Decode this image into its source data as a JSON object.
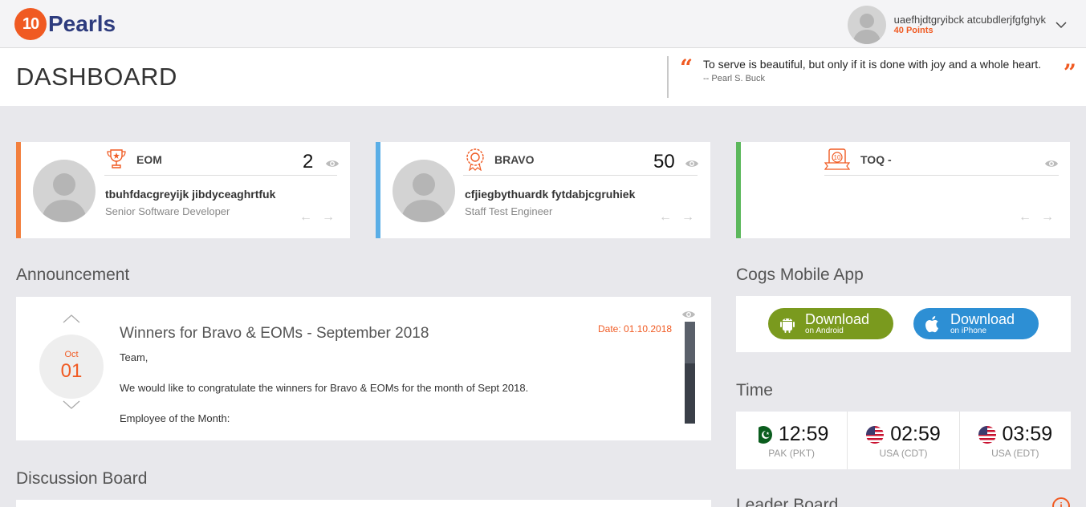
{
  "brand": {
    "logo_mark": "10",
    "logo_text": "Pearls"
  },
  "user": {
    "name": "uaefhjdtgryibck atcubdlerjfgfghyk",
    "points": "40 Points",
    "menu_icon": "chevron-down-icon"
  },
  "header": {
    "title": "DASHBOARD",
    "quote": "To serve is beautiful, but only if it is done with joy and a whole heart.",
    "quote_author": "-- Pearl S. Buck"
  },
  "awards": [
    {
      "title": "EOM",
      "count": "2",
      "name": "tbuhfdacgreyijk jibdyceaghrtfuk",
      "role": "Senior Software Developer",
      "accent": "#f27f3d",
      "icon": "trophy-icon"
    },
    {
      "title": "BRAVO",
      "count": "50",
      "name": "cfjiegbythuardk fytdabjcgruhiek",
      "role": "Staff Test Engineer",
      "accent": "#5aaee6",
      "icon": "medal-icon"
    },
    {
      "title": "TOQ -",
      "count": "",
      "name": "",
      "role": "",
      "accent": "#5cb85c",
      "icon": "ribbon-icon"
    }
  ],
  "announcement": {
    "heading": "Announcement",
    "month": "Oct",
    "day": "01",
    "title": "Winners for Bravo & EOMs - September 2018",
    "date_label": "Date: 01.10.2018",
    "body": [
      "Team,",
      "We would like to congratulate the winners for Bravo & EOMs for the month of Sept 2018.",
      "Employee of the Month:"
    ]
  },
  "discussion": {
    "heading": "Discussion Board"
  },
  "mobile_app": {
    "heading": "Cogs Mobile App",
    "android": {
      "main": "Download",
      "sub": "on Android",
      "color": "#7a9a1e"
    },
    "iphone": {
      "main": "Download",
      "sub": "on iPhone",
      "color": "#2d8fd4"
    }
  },
  "time": {
    "heading": "Time",
    "clocks": [
      {
        "time": "12:59",
        "zone": "PAK (PKT)",
        "flag": "pakistan-flag-icon"
      },
      {
        "time": "02:59",
        "zone": "USA (CDT)",
        "flag": "usa-flag-icon"
      },
      {
        "time": "03:59",
        "zone": "USA (EDT)",
        "flag": "usa-flag-icon"
      }
    ]
  },
  "leaderboard": {
    "heading": "Leader Board"
  },
  "colors": {
    "accent": "#f05a22",
    "brand_blue": "#2e3c7e"
  }
}
